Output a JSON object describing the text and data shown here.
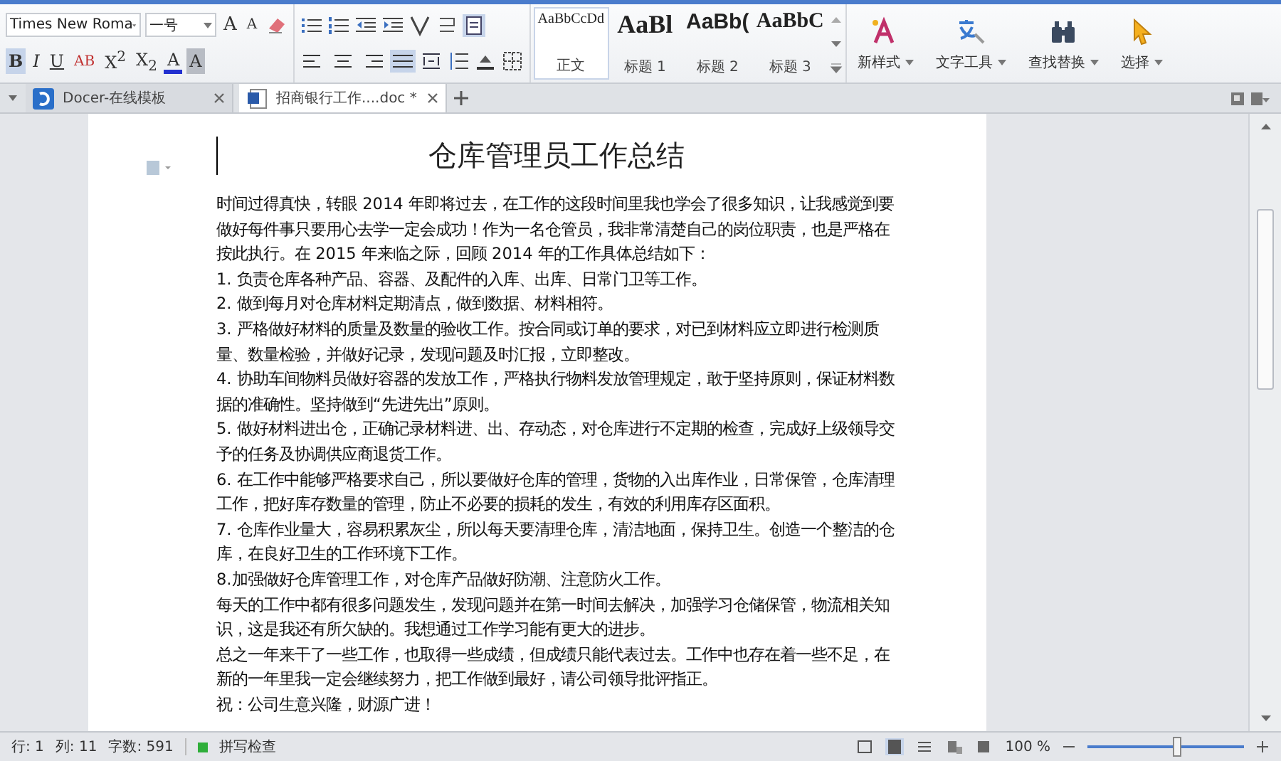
{
  "toolbar": {
    "font_name": "Times New Roma",
    "font_size": "一号",
    "size_buttons": [
      "A",
      "A"
    ],
    "format_buttons": [
      {
        "label": "B",
        "selected": true,
        "kind": "bold"
      },
      {
        "label": "I",
        "selected": false,
        "kind": "italic"
      },
      {
        "label": "U",
        "selected": false,
        "kind": "underline"
      },
      {
        "label": "AB",
        "selected": false,
        "kind": "strike"
      },
      {
        "label": "X$^{2}$",
        "selected": false,
        "kind": "plain"
      },
      {
        "label": "X$_{2}$",
        "selected": false,
        "kind": "plain"
      },
      {
        "label": "A",
        "selected": false,
        "kind": "fontcolor"
      },
      {
        "label": "A",
        "selected": false,
        "kind": "shade"
      }
    ],
    "align_buttons": [
      {
        "selected": false
      },
      {
        "selected": false
      },
      {
        "selected": false
      },
      {
        "selected": true
      }
    ],
    "styles": [
      {
        "sample": "AaBbCcDd",
        "name": "正文",
        "kind": "normal"
      },
      {
        "sample": "AaBl",
        "name": "标题 1",
        "kind": "h1"
      },
      {
        "sample": "AaBb(",
        "name": "标题 2",
        "kind": "h2"
      },
      {
        "sample": "AaBbC",
        "name": "标题 3",
        "kind": "h3"
      }
    ],
    "big_buttons": [
      {
        "label": "新样式",
        "kind": "style"
      },
      {
        "label": "文字工具",
        "kind": "text"
      },
      {
        "label": "查找替换",
        "kind": "find"
      },
      {
        "label": "选择",
        "kind": "select"
      }
    ]
  },
  "tabs": [
    {
      "label": "Docer-在线模板",
      "selected": false,
      "kind": "docer"
    },
    {
      "label": "招商银行工作....doc *",
      "selected": true,
      "kind": "doc"
    }
  ],
  "document": {
    "title": "仓库管理员工作总结",
    "paragraphs": [
      "时间过得真快，转眼 2014 年即将过去，在工作的这段时间里我也学会了很多知识，让我感觉到要做好每件事只要用心去学一定会成功！作为一名仓管员，我非常清楚自己的岗位职责，也是严格在按此执行。在 2015 年来临之际，回顾 2014 年的工作具体总结如下：",
      "1. 负责仓库各种产品、容器、及配件的入库、出库、日常门卫等工作。",
      "2. 做到每月对仓库材料定期清点，做到数据、材料相符。",
      "3. 严格做好材料的质量及数量的验收工作。按合同或订单的要求，对已到材料应立即进行检测质量、数量检验，并做好记录，发现问题及时汇报，立即整改。",
      "4. 协助车间物料员做好容器的发放工作，严格执行物料发放管理规定，敢于坚持原则，保证材料数据的准确性。坚持做到“先进先出”原则。",
      "5. 做好材料进出仓，正确记录材料进、出、存动态，对仓库进行不定期的检查，完成好上级领导交予的任务及协调供应商退货工作。",
      "6. 在工作中能够严格要求自己，所以要做好仓库的管理，货物的入出库作业，日常保管，仓库清理工作，把好库存数量的管理，防止不必要的损耗的发生，有效的利用库存区面积。",
      "7. 仓库作业量大，容易积累灰尘，所以每天要清理仓库，清洁地面，保持卫生。创造一个整洁的仓库，在良好卫生的工作环境下工作。",
      "8.加强做好仓库管理工作，对仓库产品做好防潮、注意防火工作。",
      "每天的工作中都有很多问题发生，发现问题并在第一时间去解决，加强学习仓储保管，物流相关知识，这是我还有所欠缺的。我想通过工作学习能有更大的进步。",
      "总之一年来干了一些工作，也取得一些成绩，但成绩只能代表过去。工作中也存在着一些不足，在新的一年里我一定会继续努力，把工作做到最好，请公司领导批评指正。",
      "祝：公司生意兴隆，财源广进！"
    ]
  },
  "status_bar": {
    "line": "行: 1",
    "column": "列: 11",
    "word_count": "字数: 591",
    "spell_check": "拼写检查",
    "zoom": "100 %",
    "zoom_level": {
      "level": 0.57
    }
  }
}
